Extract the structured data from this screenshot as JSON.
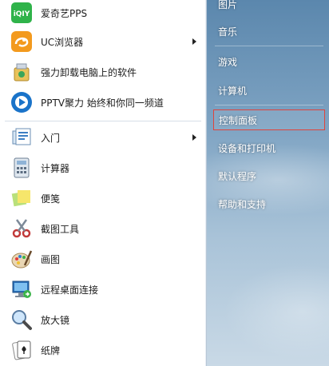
{
  "left_menu": {
    "items": [
      {
        "label": "爱奇艺PPS",
        "icon": "iqiyi-icon",
        "has_submenu": false
      },
      {
        "label": "UC浏览器",
        "icon": "uc-browser-icon",
        "has_submenu": true
      },
      {
        "label": "强力卸载电脑上的软件",
        "icon": "uninstall-icon",
        "has_submenu": false
      },
      {
        "label": "PPTV聚力 始终和你同一频道",
        "icon": "pptv-icon",
        "has_submenu": false
      },
      {
        "label": "入门",
        "icon": "getting-started-icon",
        "has_submenu": true
      },
      {
        "label": "计算器",
        "icon": "calculator-icon",
        "has_submenu": false
      },
      {
        "label": "便笺",
        "icon": "sticky-notes-icon",
        "has_submenu": false
      },
      {
        "label": "截图工具",
        "icon": "snipping-tool-icon",
        "has_submenu": false
      },
      {
        "label": "画图",
        "icon": "paint-icon",
        "has_submenu": false
      },
      {
        "label": "远程桌面连接",
        "icon": "remote-desktop-icon",
        "has_submenu": false
      },
      {
        "label": "放大镜",
        "icon": "magnifier-icon",
        "has_submenu": false
      },
      {
        "label": "纸牌",
        "icon": "solitaire-icon",
        "has_submenu": false
      }
    ]
  },
  "right_menu": {
    "items": [
      {
        "label": "图片"
      },
      {
        "label": "音乐"
      },
      {
        "label": "游戏"
      },
      {
        "label": "计算机"
      },
      {
        "label": "控制面板",
        "selected": true
      },
      {
        "label": "设备和打印机"
      },
      {
        "label": "默认程序"
      },
      {
        "label": "帮助和支持"
      }
    ]
  },
  "colors": {
    "highlight_border": "#e0443c",
    "right_pane_top": "#5b87ad",
    "iqiyi_green": "#2fb34a",
    "uc_orange": "#f39a1e",
    "pptv_blue": "#1a73c9"
  }
}
